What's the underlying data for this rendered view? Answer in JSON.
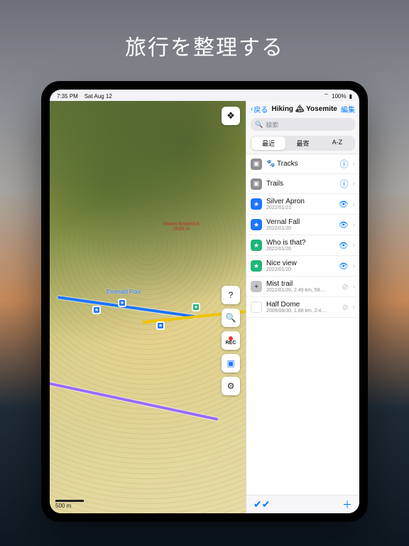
{
  "hero": {
    "title": "旅行を整理する"
  },
  "status": {
    "time": "7:35 PM",
    "date": "Sat Aug 12",
    "battery": "100%"
  },
  "map": {
    "emerald_label": "Emerald Pool",
    "peak_name": "Mount Broderick",
    "peak_elev": "2045 m",
    "scale": "500 m",
    "tools": {
      "rec": "REC"
    }
  },
  "sidebar": {
    "back": "戻る",
    "title": "Hiking 🏔 Yosemite",
    "edit": "編集",
    "search_placeholder": "検索",
    "segments": [
      "最近",
      "最寄",
      "A-Z"
    ],
    "items": [
      {
        "icon": "folder",
        "name": "🐾 Tracks",
        "sub": "",
        "trailing": "info-chevron"
      },
      {
        "icon": "folder",
        "name": "Trails",
        "sub": "",
        "trailing": "info-chevron"
      },
      {
        "icon": "blue",
        "name": "Silver Apron",
        "sub": "2022/01/21",
        "trailing": "eye-on"
      },
      {
        "icon": "blue",
        "name": "Vernal Fall",
        "sub": "2022/01/20",
        "trailing": "eye-on"
      },
      {
        "icon": "green",
        "name": "Who is that?",
        "sub": "2022/01/20",
        "trailing": "eye-on"
      },
      {
        "icon": "green",
        "name": "Nice view",
        "sub": "2022/01/20",
        "trailing": "eye-on"
      },
      {
        "icon": "gray",
        "name": "Mist trail",
        "sub": "2022/01/20, 2.49 km, 59…",
        "trailing": "eye-off"
      },
      {
        "icon": "orange",
        "name": "Half Dome",
        "sub": "2009/08/30, 1.88 km, 2:4…",
        "trailing": "eye-off"
      }
    ]
  }
}
